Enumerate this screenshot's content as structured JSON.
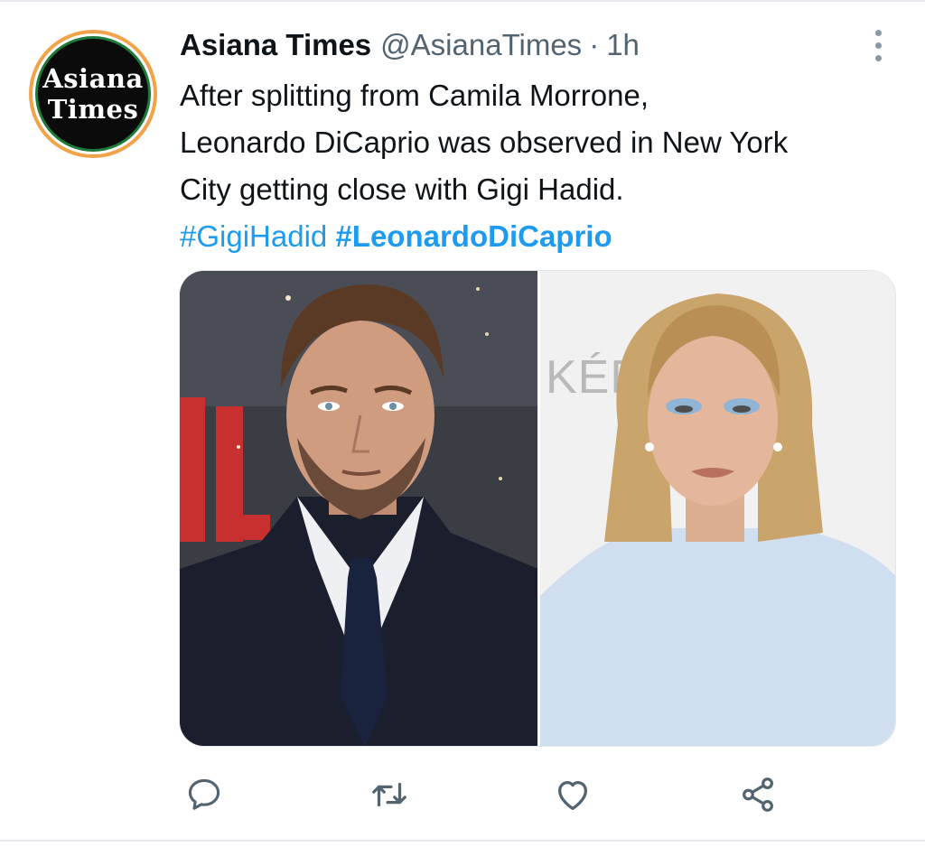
{
  "tweet": {
    "author_name": "Asiana Times",
    "author_handle": "@AsianaTimes",
    "separator": "·",
    "time": "1h",
    "avatar_text": [
      "Asiana",
      "Times"
    ],
    "lines": [
      "After splitting from Camila Morrone,",
      "Leonardo DiCaprio was observed in New York",
      "City getting close with Gigi Hadid."
    ],
    "hashtags": [
      "#GigiHadid",
      "#LeonardoDiCaprio"
    ],
    "media_text": "KÉRA"
  },
  "actions": {
    "icons": [
      "reply-icon",
      "retweet-icon",
      "like-icon",
      "share-icon"
    ]
  },
  "colors": {
    "link": "#1d9bf0",
    "secondary_text": "#536471",
    "icon": "#536471"
  }
}
